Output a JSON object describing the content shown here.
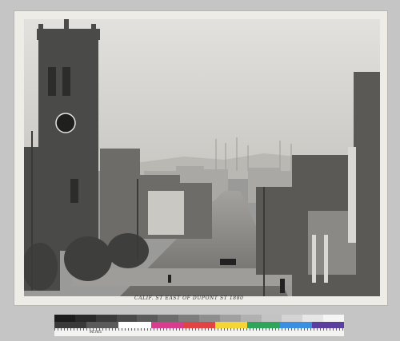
{
  "caption": "CALIF. ST EAST OF DUPONT ST 1880",
  "colors": {
    "mount": "#eeece6",
    "background": "#c5c5c5",
    "sky": "#dcdbd6",
    "building_dark": "#4a4a48"
  },
  "grayscale_patches": [
    "#1c1c1c",
    "#2a2a2a",
    "#3a3a3a",
    "#4a4a4a",
    "#5b5b5b",
    "#6c6c6c",
    "#7d7d7d",
    "#8e8e8e",
    "#a0a0a0",
    "#b1b1b1",
    "#c3c3c3",
    "#d4d4d4",
    "#e6e6e6",
    "#f5f5f5"
  ],
  "color_patches": [
    "#3a3a3a",
    "#5a5a5a",
    "#ffffff",
    "#d83c8c",
    "#e24444",
    "#f5d535",
    "#2fa55c",
    "#3b8fe0",
    "#5a3f9e"
  ],
  "ruler_text": "INCHES"
}
